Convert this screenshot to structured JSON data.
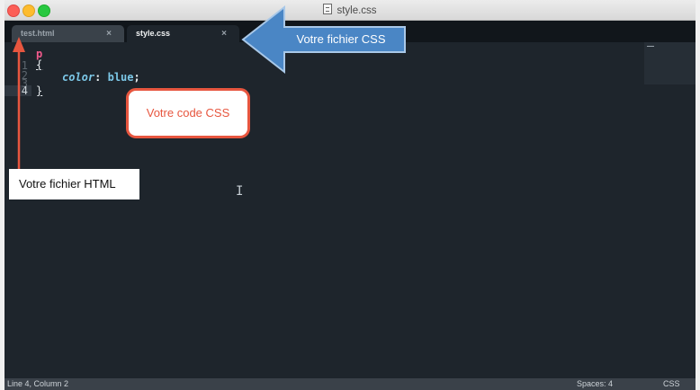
{
  "window": {
    "title": "style.css"
  },
  "tabs": [
    {
      "label": "test.html",
      "close": "×",
      "active": false
    },
    {
      "label": "style.css",
      "close": "×",
      "active": true
    }
  ],
  "editor": {
    "line_numbers": [
      "1",
      "2",
      "3",
      "4"
    ],
    "current_line": 4,
    "code": {
      "selector": "p",
      "open_brace": "{",
      "property": "color",
      "colon": ":",
      "value": "blue",
      "semicolon": ";",
      "close_brace": "}"
    }
  },
  "statusbar": {
    "position": "Line 4, Column 2",
    "spaces": "Spaces: 4",
    "syntax": "CSS"
  },
  "annotations": {
    "html_file": "Votre fichier HTML",
    "css_code": "Votre code CSS",
    "css_file": "Votre fichier CSS"
  },
  "colors": {
    "editor_bg": "#1e252c",
    "selector": "#f25a8c",
    "property": "#7cc8e8",
    "annotation_red": "#e7563f",
    "annotation_blue": "#4a86c5"
  },
  "icons": [
    "file-icon",
    "tab-close-icon",
    "text-cursor-icon",
    "arrow-up-icon",
    "arrow-left-icon"
  ]
}
